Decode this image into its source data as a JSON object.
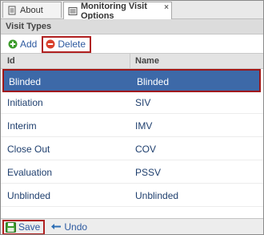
{
  "tabs": [
    {
      "label": "About"
    },
    {
      "label": "Monitoring Visit Options",
      "close": "×"
    }
  ],
  "section": {
    "title": "Visit Types"
  },
  "toolbar": {
    "add_label": "Add",
    "delete_label": "Delete"
  },
  "grid": {
    "columns": {
      "id": "Id",
      "name": "Name"
    },
    "rows": [
      {
        "id": "Blinded",
        "name": "Blinded"
      },
      {
        "id": "Initiation",
        "name": "SIV"
      },
      {
        "id": "Interim",
        "name": "IMV"
      },
      {
        "id": "Close Out",
        "name": "COV"
      },
      {
        "id": "Evaluation",
        "name": "PSSV"
      },
      {
        "id": "Unblinded",
        "name": "Unblinded"
      }
    ],
    "selected_index": 0
  },
  "bottom": {
    "save_label": "Save",
    "undo_label": "Undo"
  },
  "icons": {
    "about": "document-icon",
    "options": "list-icon",
    "add": "plus-circle-icon",
    "delete": "minus-circle-icon",
    "save": "floppy-disk-icon",
    "undo": "undo-arrow-icon"
  },
  "colors": {
    "selected_row": "#3d69a8",
    "highlight_border": "#b02020",
    "add_icon": "#3b9b2a",
    "delete_icon": "#d9402b",
    "link_text": "#2e5aa0"
  }
}
